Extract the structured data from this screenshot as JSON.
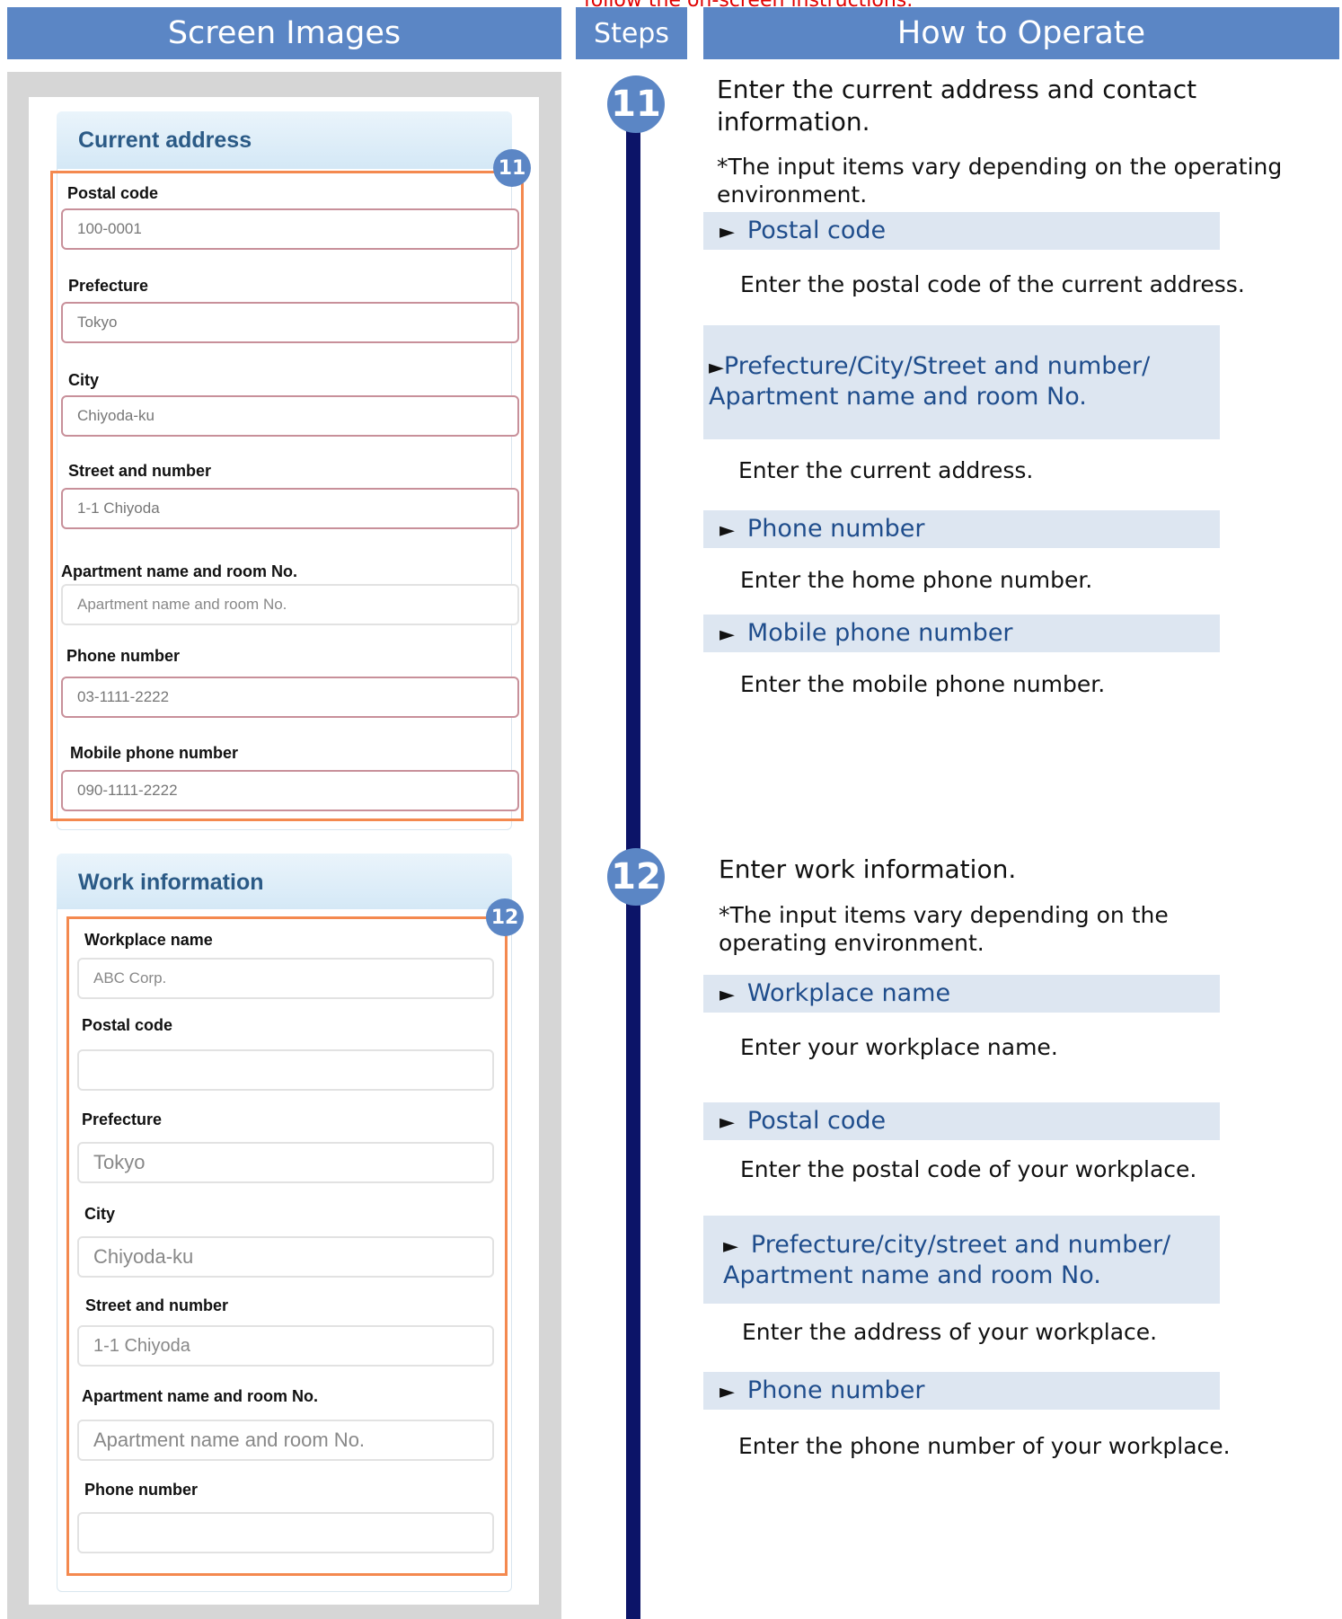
{
  "top_note": "follow the on-screen instructions.",
  "headers": {
    "screen_images": "Screen Images",
    "steps": "Steps",
    "how_to_operate": "How to Operate"
  },
  "screen": {
    "current_address": {
      "title": "Current address",
      "badge": "11",
      "fields": [
        {
          "label": "Postal code",
          "value": "100-0001"
        },
        {
          "label": "Prefecture",
          "value": "Tokyo"
        },
        {
          "label": "City",
          "value": "Chiyoda-ku"
        },
        {
          "label": "Street and number",
          "value": "1-1 Chiyoda"
        },
        {
          "label": "Apartment name and room No.",
          "placeholder": "Apartment name and room No."
        },
        {
          "label": "Phone number",
          "value": "03-1111-2222"
        },
        {
          "label": "Mobile phone number",
          "value": "090-1111-2222"
        }
      ]
    },
    "work_information": {
      "title": "Work information",
      "badge": "12",
      "fields": [
        {
          "label": "Workplace name",
          "value": "ABC Corp."
        },
        {
          "label": "Postal code",
          "value": ""
        },
        {
          "label": "Prefecture",
          "value": "Tokyo"
        },
        {
          "label": "City",
          "value": "Chiyoda-ku"
        },
        {
          "label": "Street and number",
          "value": "1-1 Chiyoda"
        },
        {
          "label": "Apartment name and room No.",
          "placeholder": "Apartment name and room No."
        },
        {
          "label": "Phone number",
          "value": ""
        }
      ]
    }
  },
  "steps": {
    "step11": {
      "number": "11",
      "title": "Enter the current address and contact information.",
      "note": "*The input items vary depending on the operating environment.",
      "items": [
        {
          "label": "Postal code",
          "desc": "Enter the postal code of the current address."
        },
        {
          "label": "Prefecture/City/Street and number/ Apartment name and room No.",
          "desc": "Enter the current address."
        },
        {
          "label": "Phone number",
          "desc": "Enter the home phone number."
        },
        {
          "label": "Mobile phone number",
          "desc": "Enter the mobile phone number."
        }
      ]
    },
    "step12": {
      "number": "12",
      "title": "Enter work information.",
      "note": "*The input items vary depending on the operating environment.",
      "items": [
        {
          "label": "Workplace name",
          "desc": "Enter your workplace name."
        },
        {
          "label": "Postal code",
          "desc": "Enter the postal code of your workplace."
        },
        {
          "label": "Prefecture/city/street and number/ Apartment name and room No.",
          "desc": "Enter the address of your workplace."
        },
        {
          "label": "Phone number",
          "desc": "Enter the phone number of your workplace."
        }
      ]
    }
  },
  "triangle": "►"
}
